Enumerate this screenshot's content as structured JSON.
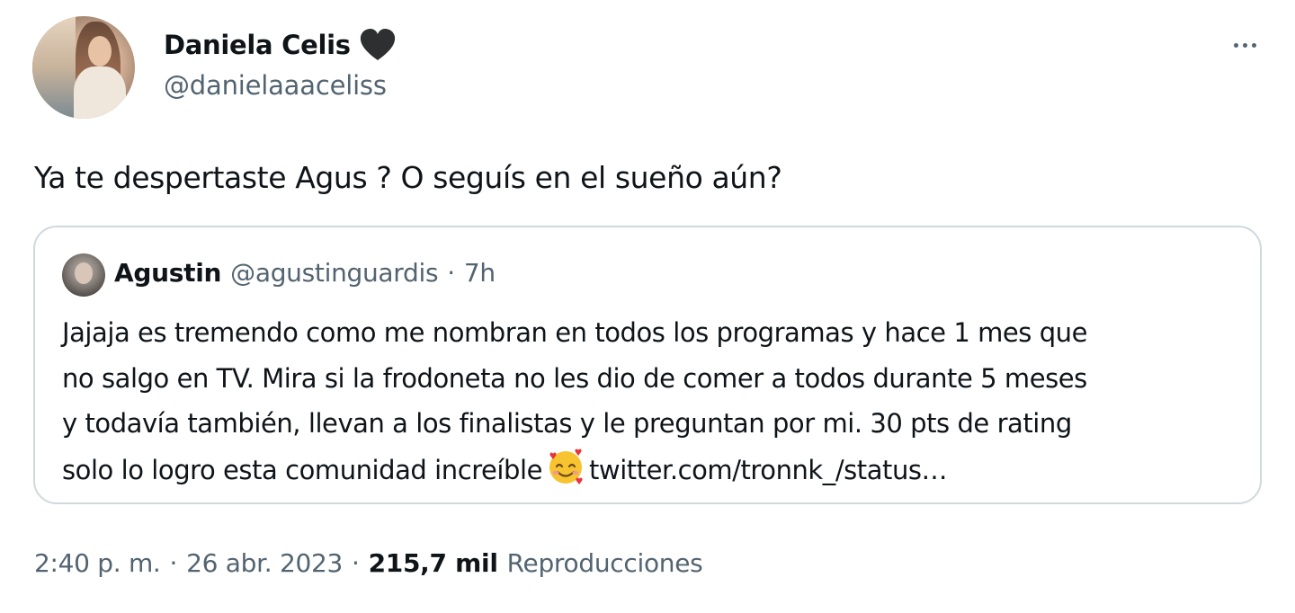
{
  "tweet": {
    "author": {
      "display_name": "Daniela Celis",
      "handle": "@danielaaaceliss",
      "badge_icon": "black-heart-icon"
    },
    "text": "Ya te despertaste Agus ? O seguís en el sueño aún?",
    "more_icon": "more-dots-icon"
  },
  "quote": {
    "author": {
      "display_name": "Agustin",
      "handle": "@agustinguardis"
    },
    "separator": "·",
    "time": "7h",
    "lines": [
      "Jajaja es tremendo como me nombran en todos los programas y hace 1 mes que",
      "no salgo en TV. Mira si la frodoneta no les dio de comer a todos durante 5 meses",
      "y todavía también, llevan a los finalistas y le preguntan por mi. 30 pts de rating",
      "solo lo logro esta comunidad increíble"
    ],
    "emoji_icon": "smiling-face-with-hearts-icon",
    "link": "twitter.com/tronnk_/status…"
  },
  "meta": {
    "time": "2:40 p. m.",
    "separator": "·",
    "date": "26 abr. 2023",
    "views_count": "215,7 mil",
    "views_label": "Reproducciones"
  },
  "colors": {
    "primary_text": "#0f1419",
    "secondary_text": "#536471",
    "border": "#cfd9de",
    "background": "#ffffff"
  }
}
